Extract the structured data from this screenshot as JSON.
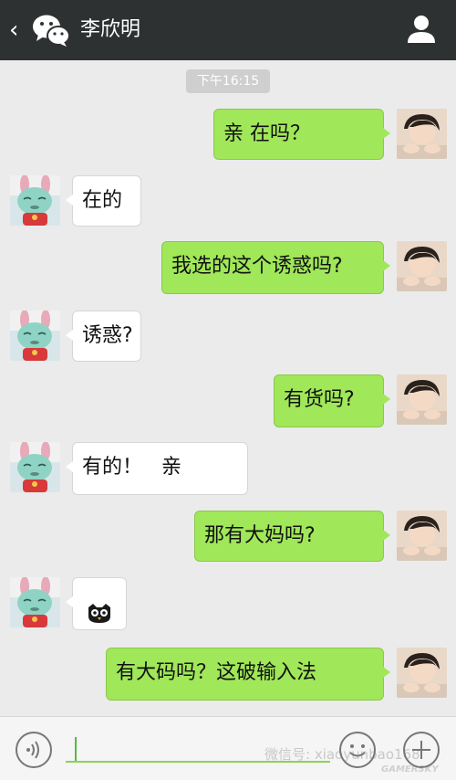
{
  "header": {
    "back_icon": "chevron-left-icon",
    "logo_icon": "wechat-icon",
    "title": "李欣明",
    "profile_icon": "person-icon"
  },
  "chat": {
    "timestamp": "下午16:15",
    "messages": [
      {
        "sender": "me",
        "text": "亲  在吗？"
      },
      {
        "sender": "them",
        "text": "在的"
      },
      {
        "sender": "me",
        "text": "我选的这个诱惑吗?"
      },
      {
        "sender": "them",
        "text": "诱惑?"
      },
      {
        "sender": "me",
        "text": "有货吗?"
      },
      {
        "sender": "them",
        "text": "有的！   亲"
      },
      {
        "sender": "me",
        "text": "那有大妈吗?"
      },
      {
        "sender": "them",
        "emoji": "owl-emoji-icon"
      },
      {
        "sender": "me",
        "text": "有大码吗？这破输入法"
      }
    ]
  },
  "input_bar": {
    "voice_icon": "voice-icon",
    "emoji_icon": "smiley-icon",
    "plus_icon": "plus-icon",
    "watermark": "微信号: xiaoyunbao168",
    "watermark_site": "GAMERSKY"
  }
}
